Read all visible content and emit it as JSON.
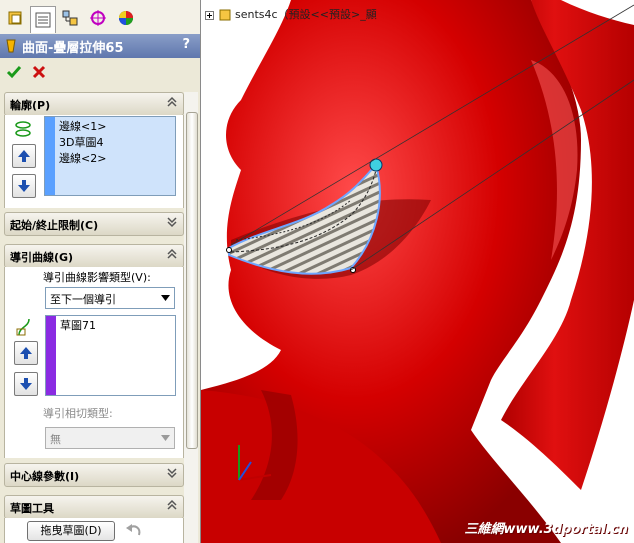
{
  "feature": {
    "title": "曲面-疊層拉伸65",
    "help": "?"
  },
  "tabs": [
    "feature-manager-icon",
    "property-manager-icon",
    "configuration-manager-icon",
    "dimxpert-icon",
    "display-manager-icon"
  ],
  "sections": {
    "profile": {
      "label": "輪廓(P)",
      "items": [
        "邊線<1>",
        "3D草圖4",
        "邊線<2>"
      ]
    },
    "start_end": {
      "label": "起始/終止限制(C)"
    },
    "guide": {
      "label": "導引曲線(G)",
      "influence_label": "導引曲線影響類型(V):",
      "influence_value": "至下一個導引",
      "items": [
        "草圖71"
      ],
      "tangency_label": "導引相切類型:",
      "tangency_value": "無"
    },
    "centerline": {
      "label": "中心線參數(I)"
    },
    "sketch_tools": {
      "label": "草圖工具",
      "drag_button": "拖曳草圖(D)"
    }
  },
  "viewport": {
    "tree_text": "sents4c（預設<<預設>_顯",
    "watermark": "三維網www.3dportal.cn"
  },
  "colors": {
    "model": "#d40000",
    "selection": "#5aa0ff",
    "guide_bar": "#8a2be2",
    "accept": "#1a9a1a",
    "cancel": "#cc1010"
  }
}
